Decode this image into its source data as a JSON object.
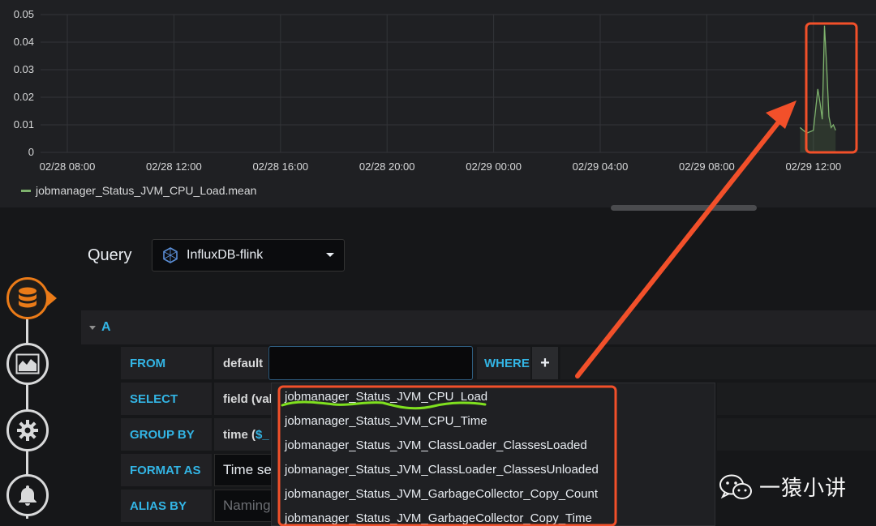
{
  "chart_data": {
    "type": "line",
    "ylim": [
      0,
      0.05
    ],
    "y_ticks": [
      "0",
      "0.01",
      "0.02",
      "0.03",
      "0.04",
      "0.05"
    ],
    "x_ticks": [
      "02/28 08:00",
      "02/28 12:00",
      "02/28 16:00",
      "02/28 20:00",
      "02/29 00:00",
      "02/29 04:00",
      "02/29 08:00",
      "02/29 12:00"
    ],
    "grid": true,
    "legend_position": "bottom-left",
    "series": [
      {
        "name": "jobmanager_Status_JVM_CPU_Load.mean",
        "color": "#7eb26d",
        "x": [
          "02/29 11:30",
          "02/29 11:45",
          "02/29 12:00",
          "02/29 12:10",
          "02/29 12:15",
          "02/29 12:20",
          "02/29 12:25",
          "02/29 12:30",
          "02/29 12:35",
          "02/29 12:40",
          "02/29 12:45",
          "02/29 12:50"
        ],
        "values": [
          0.009,
          0.007,
          0.008,
          0.023,
          0.018,
          0.012,
          0.046,
          0.031,
          0.013,
          0.009,
          0.01,
          0.008
        ]
      }
    ]
  },
  "legend": {
    "label": "jobmanager_Status_JVM_CPU_Load.mean"
  },
  "editor": {
    "title": "Query",
    "datasource": "InfluxDB-flink",
    "query_letter": "A",
    "from": {
      "label": "FROM",
      "policy": "default",
      "measurement": "",
      "where_label": "WHERE",
      "add": "+"
    },
    "select": {
      "label": "SELECT",
      "value": "field (valu"
    },
    "group_by": {
      "label": "GROUP BY",
      "prefix": "time (",
      "var": "$_"
    },
    "format_as": {
      "label": "FORMAT AS",
      "value": "Time se"
    },
    "alias_by": {
      "label": "ALIAS BY",
      "placeholder": "Naming"
    }
  },
  "measurements": [
    "jobmanager_Status_JVM_CPU_Load",
    "jobmanager_Status_JVM_CPU_Time",
    "jobmanager_Status_JVM_ClassLoader_ClassesLoaded",
    "jobmanager_Status_JVM_ClassLoader_ClassesUnloaded",
    "jobmanager_Status_JVM_GarbageCollector_Copy_Count",
    "jobmanager_Status_JVM_GarbageCollector_Copy_Time"
  ],
  "rail_icons": [
    "database-icon",
    "chart-area-icon",
    "gear-icon",
    "bell-icon"
  ],
  "colors": {
    "accent_blue": "#33b5e5",
    "series_green": "#7eb26d",
    "annotation_red": "#f2502a",
    "active_orange": "#eb7b18",
    "underline_green": "#7fe01f"
  },
  "watermark": {
    "text": "一猿小讲"
  }
}
